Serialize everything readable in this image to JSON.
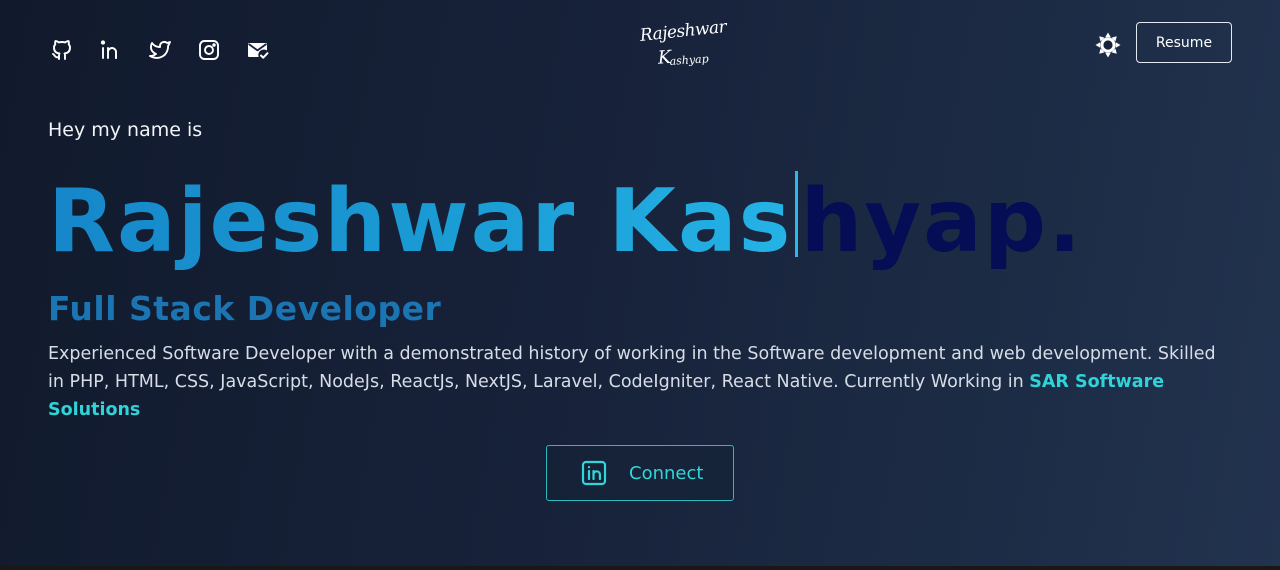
{
  "header": {
    "social_icons": [
      "github-icon",
      "linkedin-icon",
      "twitter-icon",
      "instagram-icon",
      "mail-check-icon"
    ],
    "logo_line1": "Rajeshwar",
    "logo_line2_cap": "K",
    "logo_line2": "ashyap",
    "theme_icon": "sun-icon",
    "resume_label": "Resume"
  },
  "hero": {
    "greeting": "Hey my name is",
    "name_typed": "Rajeshwar Kas",
    "name_rest": "hyap.",
    "role": "Full Stack Developer",
    "bio": "Experienced Software Developer with a demonstrated history of working in the Software development and web development. Skilled in PHP, HTML, CSS, JavaScript, NodeJs, ReactJs, NextJS, Laravel, CodeIgniter, React Native. Currently Working in ",
    "company": "SAR Software Solutions",
    "connect_label": "Connect",
    "connect_icon": "linkedin-icon"
  },
  "colors": {
    "name_gradient_start": "#1687c9",
    "name_gradient_end": "#25b3e6",
    "name_untyped": "#050e54",
    "role": "#1b75b3",
    "accent_teal": "#2fd3d8",
    "background": "#17223a"
  }
}
